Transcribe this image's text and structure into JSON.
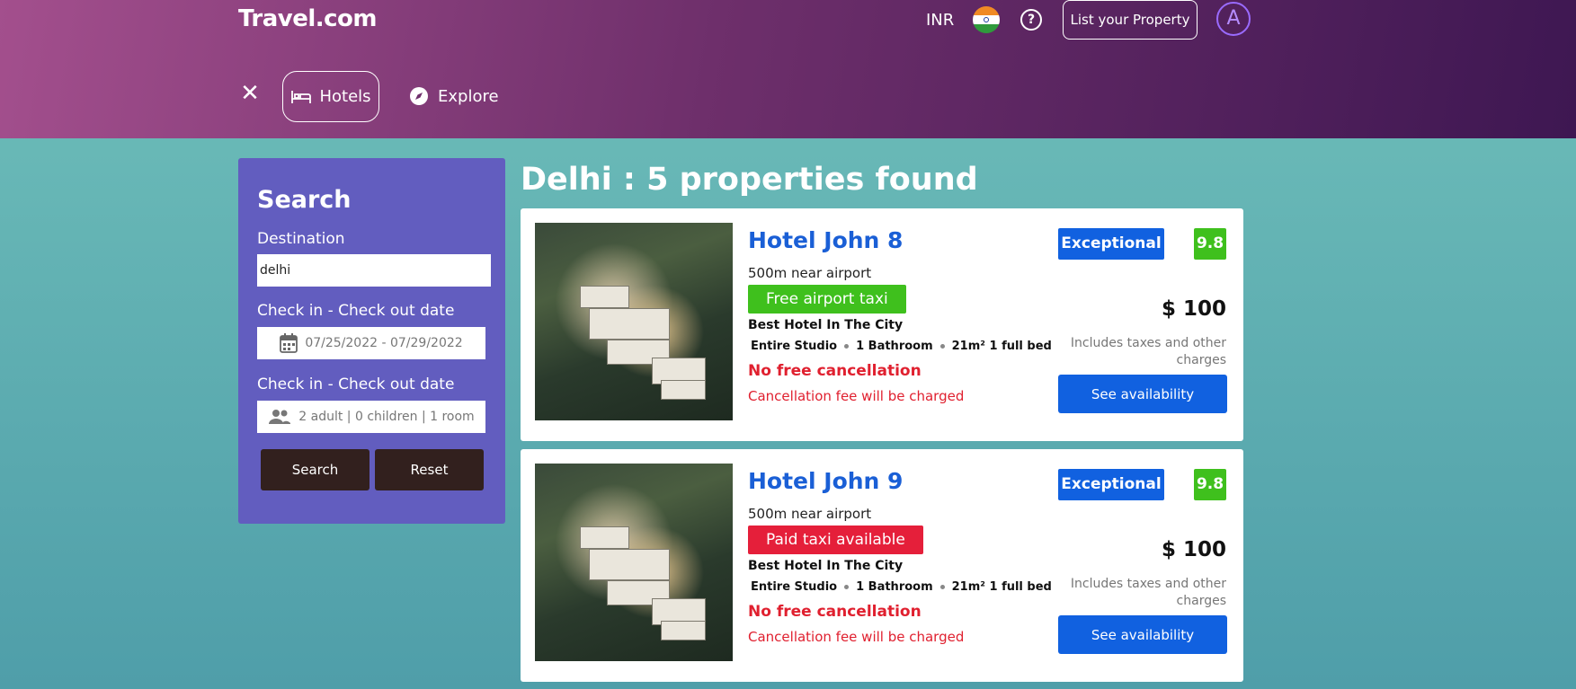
{
  "header": {
    "logo": "Travel.com",
    "currency": "INR",
    "help_icon": "help-circle-icon",
    "list_property_label": "List your Property",
    "avatar_initial": "A",
    "nav": {
      "close_icon": "close-icon",
      "hotels_label": "Hotels",
      "hotels_icon": "bed-icon",
      "explore_label": "Explore",
      "explore_icon": "compass-icon"
    },
    "colors": {
      "gradient_start": "#a34f8d",
      "gradient_end": "#3e1752"
    }
  },
  "search": {
    "title": "Search",
    "destination_label": "Destination",
    "destination_value": "delhi",
    "dates_label": "Check in - Check out date",
    "dates_value": "07/25/2022 - 07/29/2022",
    "dates_icon": "calendar-icon",
    "guests_label": "Check in - Check out date",
    "guests_value": "2 adult | 0 children | 1 room",
    "guests_icon": "people-icon",
    "search_button": "Search",
    "reset_button": "Reset",
    "panel_color": "#625dbf"
  },
  "results": {
    "title": "Delhi : 5 properties found",
    "hotels": [
      {
        "name": "Hotel John 8",
        "distance": "500m near airport",
        "taxi": "Free airport taxi",
        "taxi_color": "#3fc01d",
        "tagline": "Best Hotel In The City",
        "specs": [
          "Entire Studio",
          "1 Bathroom",
          "21m² 1 full bed"
        ],
        "cancellation": "No free cancellation",
        "fee_note": "Cancellation fee will be charged",
        "rating_word": "Exceptional",
        "rating_score": "9.8",
        "price": "$ 100",
        "taxes_note": "Includes taxes and other charges",
        "availability_button": "See availability"
      },
      {
        "name": "Hotel John 9",
        "distance": "500m near airport",
        "taxi": "Paid taxi available",
        "taxi_color": "#e51f3a",
        "tagline": "Best Hotel In The City",
        "specs": [
          "Entire Studio",
          "1 Bathroom",
          "21m² 1 full bed"
        ],
        "cancellation": "No free cancellation",
        "fee_note": "Cancellation fee will be charged",
        "rating_word": "Exceptional",
        "rating_score": "9.8",
        "price": "$ 100",
        "taxes_note": "Includes taxes and other charges",
        "availability_button": "See availability"
      }
    ]
  }
}
